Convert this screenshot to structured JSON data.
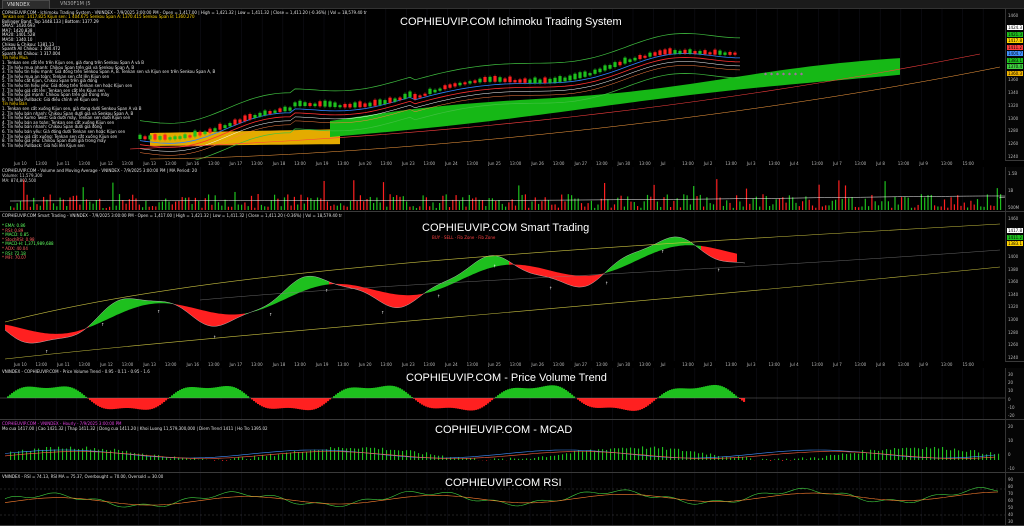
{
  "window": {
    "tabs": [
      {
        "label": "VNINDEX (Weekly)",
        "active": true
      },
      {
        "label": "VN30F1M (5 minute)",
        "active": false
      }
    ]
  },
  "colors": {
    "bull": "#1ec01e",
    "bear": "#ff2020",
    "kumo_bull": "#16b816",
    "kumo_bear": "#f0b400",
    "accent_yellow": "#ffd200",
    "magenta": "#ff40ff"
  },
  "panes": {
    "ichimoku": {
      "title": "COPHIEUVIP.COM Ichimoku Trading System",
      "header": "COPHIEUVIP.COM - Ichimoku Trading System - VNINDEX - 7/9/2025 3:00:00 PM - Open = 1,417.00 | High = 1,421.32 | Low = 1,411.32 | Close = 1,411.20 (-0.36%) | Vol = 18,579.40 tr",
      "notes": [
        "Tenkan sen: 1417.825  Kijun sen: 1 404.675  Senkou Span A: 1370.415  Senkou Span B: 1360.270",
        "Bollinger Band: Top  1448.133 | Bottom: 1377.29",
        "SMA5: 1430.693",
        "MA7: 1420.838",
        "MA20: 1401.528",
        "MA50: 1340.10",
        "Chikou & Chikou: 1381.13",
        "Spanth All Chikou: 1 380.472",
        "Spanth All Chikou: 1 317.004",
        "Tín hiệu Mua",
        "1. Tenkan sen cắt lên trên Kijun sen, giá đang trên Senkou Span A và B",
        "2. Tín hiệu mua nhanh: Chikou Span trên giá và Senkou Span A, B",
        "3. Tín hiệu tín hiệu mạnh: Giá đóng trên Senkou Span A, B. Tenkan sen và Kijun sen trên Senkou Span A, B",
        "4. Tín hiệu mua an toàn: Tenkan sen cắt lên Kijun sen",
        "5. Tín hiệu cắt Kijun, Chikou Span trên giá đóng",
        "6. Tín hiệu tín hiệu yếu: Giá đóng trên Tenkan sen hoặc Kijun sen",
        "7. Tín hiệu giá cắt lên: Tenkan sen cắt lên Kijun sen",
        "8. Tín hiệu giá mạnh: Chikou Span trên giá trong mây",
        "9. Tín hiệu Pullback: Giá điều chỉnh về Kijun sen",
        "Tín hiệu Bán",
        "1. Tenkan sen cắt xuống Kijun sen, giá đang dưới Senkou Span A và B",
        "2. Tín hiệu bán nhanh: Chikou Span dưới giá và Senkou Span A, B",
        "3. Tín hiệu Kumo Twist: Giá dưới mây, Tenkan sen dưới Kijun sen",
        "4. Tín hiệu bán an toàn: Tenkan sen cắt xuống Kijun sen",
        "5. Tín hiệu bán nhanh: Chikou Span dưới giá đóng",
        "6. Tín hiệu bán yếu: Giá đóng dưới Tenkan sen hoặc Kijun sen",
        "7. Tín hiệu giá cắt xuống: Tenkan sen cắt xuống Kijun sen",
        "8. Tín hiệu giá yếu: Chikou Span dưới giá trong mây",
        "9. Tín hiệu Pullback: Giá hồi lên Kijun sen"
      ],
      "axis_ticks": [
        "1460",
        "1440",
        "1420",
        "1400",
        "1380",
        "1360",
        "1340",
        "1320",
        "1300",
        "1280",
        "1260",
        "1240"
      ],
      "price_labels": [
        "1424.3",
        "1421.3",
        "1417.8",
        "1411.2",
        "1404.7",
        "1383.1",
        "1370.4",
        "1360.3"
      ]
    },
    "volume": {
      "header": "COPHIEUVIP.COM - Volume and Moving Average - VNINDEX - 7/9/2025 3:00:00 PM | MA Period: 20",
      "lines": [
        "Volume: 11,579,300",
        "MA: 874,802,500"
      ],
      "axis_ticks": [
        "1.5B",
        "1B",
        "500M"
      ]
    },
    "smart": {
      "title": "COPHIEUVIP.COM Smart Trading",
      "header": "COPHIEUVIP.COM Smart Trading - VNINDEX - 7/9/2025 3:00:00 PM - Open = 1,417.00 | High = 1,421.32 | Low = 1,411.32 | Close = 1,411.20 (-0.36%) | Vol = 18,579.40 tr",
      "notes": [
        "* EMA: 0.86",
        "* RSI: 0.89",
        "* MACD: 0.85",
        "* StochRSI: 0.98",
        "* MACD-H: 1,371,989,688",
        "* ADX: 40.04",
        "* RSI: 72.18",
        "* MFI: 70.07"
      ],
      "legend": "BUY · SELL · Fib Zone · Fib Zone",
      "axis_ticks": [
        "1460",
        "1440",
        "1420",
        "1400",
        "1380",
        "1360",
        "1340",
        "1320",
        "1300",
        "1280",
        "1260",
        "1240"
      ],
      "price_labels": [
        "1417.8",
        "1411.2",
        "1383.1"
      ]
    },
    "pvt": {
      "title": "COPHIEUVIP.COM - Price Volume Trend",
      "header": "VNINDEX - COPHIEUVIP.COM - Price Volume Trend - 0.95 - 0.11 - 0.95 - 1.6",
      "axis_ticks": [
        "30",
        "20",
        "10",
        "0",
        "-10",
        "-20"
      ]
    },
    "macd": {
      "title": "COPHIEUVIP.COM - MCAD",
      "header": "COPHIEUVIP.COM - VNINDEX - Hourly - 7/9/2025 3:00:00 PM",
      "sub": "Mo cua 1417.00 | Cao 1421.32 | Thap 1411.32 | Dong cua 1411.20 | Khoi Luong 11,579,300,000 | Diem Trend 1411 | Ho Tro 1395.02",
      "axis_ticks": [
        "20",
        "10",
        "0",
        "-10"
      ]
    },
    "rsi": {
      "title": "COPHIEUVIP.COM RSI",
      "header": "VNINDEX - RSI = 74.13, RSI MA = 75.37, Overbought = 70.00, Oversold = 30.00",
      "axis_ticks": [
        "90",
        "80",
        "70",
        "60",
        "50",
        "40",
        "30"
      ]
    }
  },
  "date_axis": [
    "Jun 10",
    "13:00",
    "Jun 11",
    "13:00",
    "Jun 12",
    "13:00",
    "Jun 13",
    "13:00",
    "Jun 16",
    "13:00",
    "Jun 17",
    "13:00",
    "Jun 18",
    "13:00",
    "Jun 19",
    "13:00",
    "Jun 20",
    "13:00",
    "Jun 23",
    "13:00",
    "Jun 24",
    "13:00",
    "Jun 25",
    "13:00",
    "Jun 26",
    "13:00",
    "Jun 27",
    "13:00",
    "Jun 30",
    "13:00",
    "Jul",
    "13:00",
    "Jul 2",
    "13:00",
    "Jul 3",
    "13:00",
    "Jul 4",
    "13:00",
    "Jul 7",
    "13:00",
    "Jul 8",
    "13:00",
    "Jul 9",
    "13:00",
    "15:00"
  ]
}
